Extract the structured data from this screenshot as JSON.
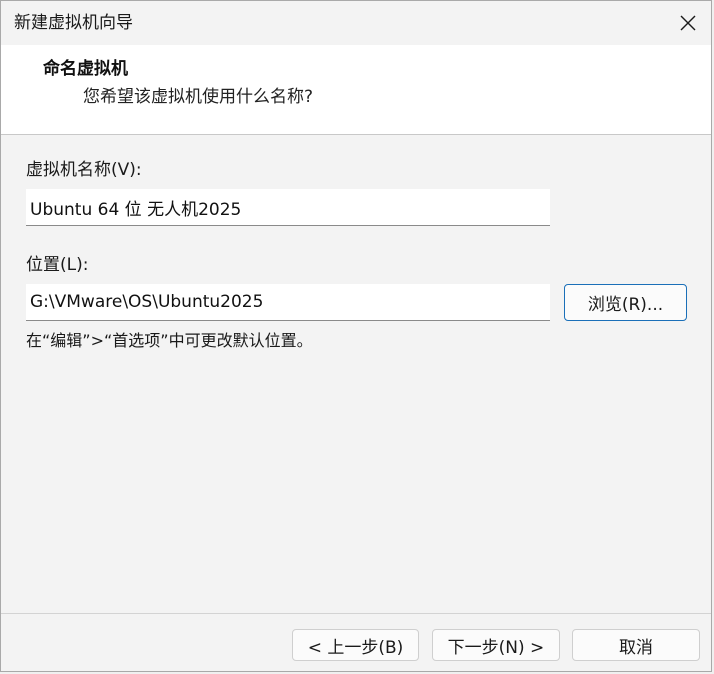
{
  "window": {
    "title": "新建虚拟机向导"
  },
  "header": {
    "title": "命名虚拟机",
    "subtitle": "您希望该虚拟机使用什么名称?"
  },
  "vm_name": {
    "label": "虚拟机名称(V):",
    "value": "Ubuntu 64 位 无人机2025"
  },
  "location": {
    "label": "位置(L):",
    "value": "G:\\VMware\\OS\\Ubuntu2025",
    "browse_label": "浏览(R)..."
  },
  "hint": "在“编辑”>“首选项”中可更改默认位置。",
  "footer": {
    "back_label": "< 上一步(B)",
    "next_label": "下一步(N) >",
    "cancel_label": "取消"
  },
  "icons": {
    "close": "close-icon"
  },
  "colors": {
    "accent": "#1a6fb8",
    "background": "#f3f3f3",
    "header_background": "#ffffff"
  }
}
